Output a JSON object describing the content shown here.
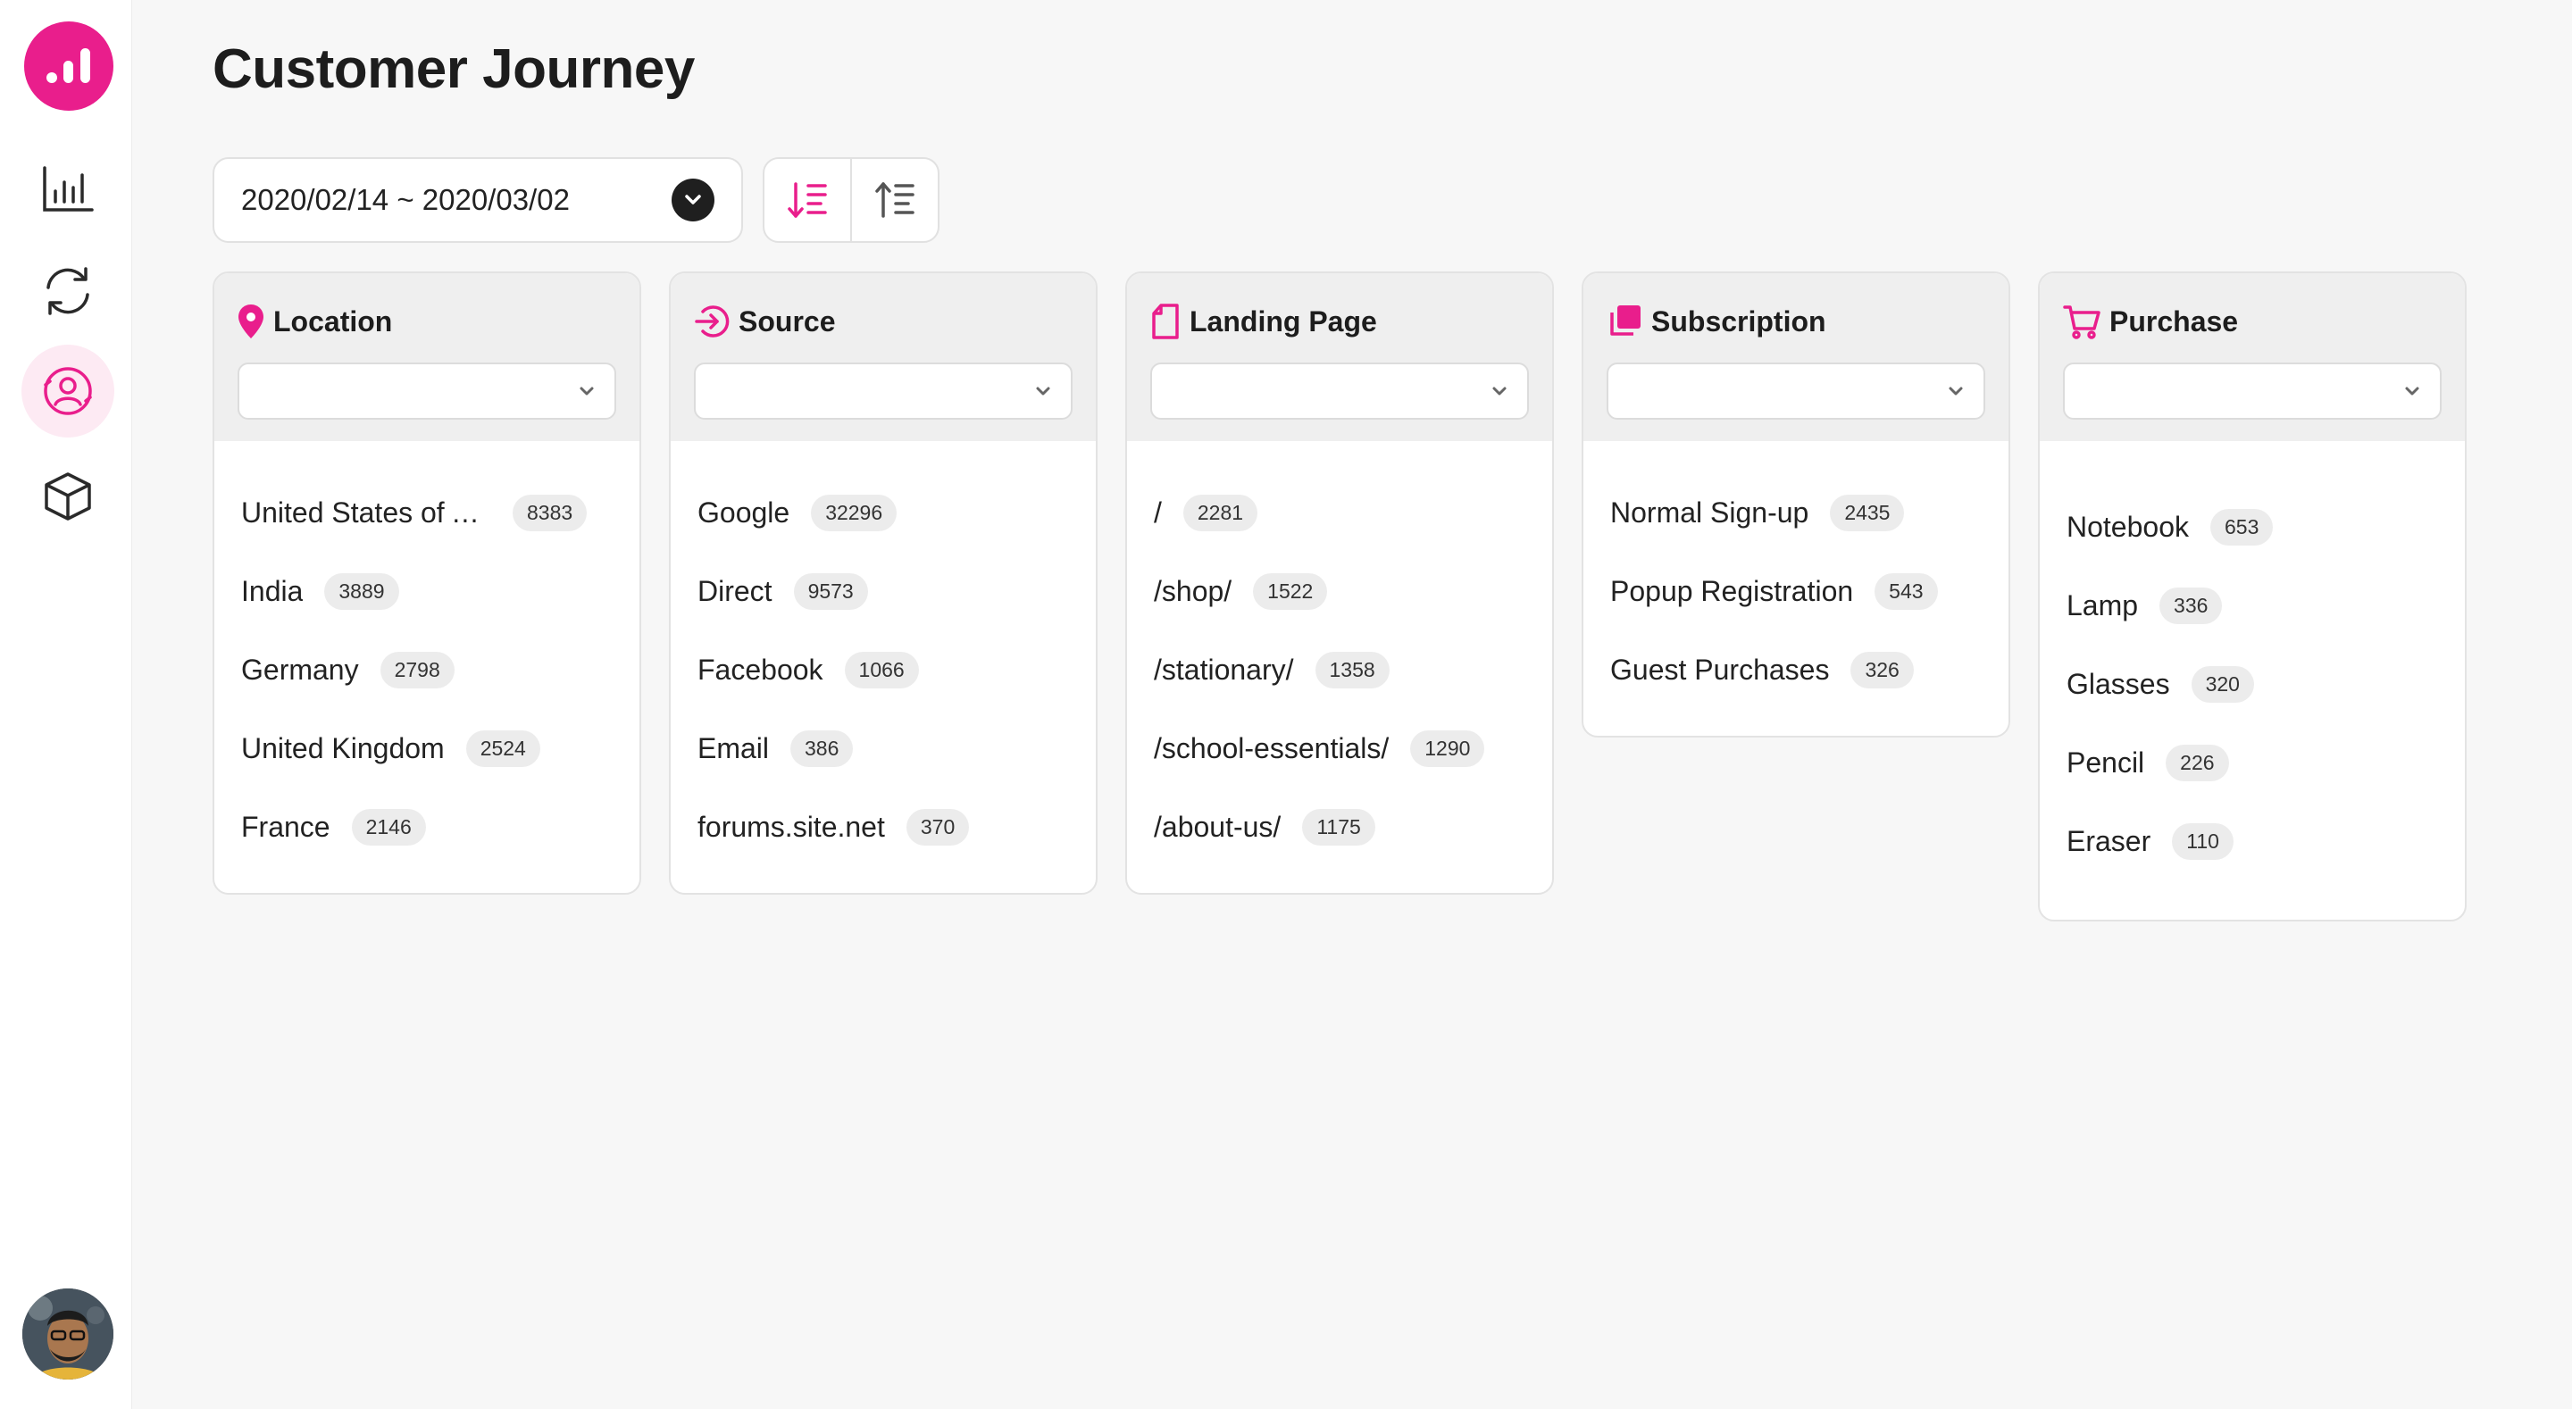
{
  "app": {
    "title": "Customer Journey"
  },
  "brand": {
    "accent": "#e91e8c"
  },
  "sidebar": {
    "items": [
      {
        "icon": "bar-chart-icon"
      },
      {
        "icon": "refresh-icon"
      },
      {
        "icon": "user-journey-icon",
        "active": true
      },
      {
        "icon": "cube-icon"
      }
    ]
  },
  "toolbar": {
    "date_range": "2020/02/14 ~ 2020/03/02"
  },
  "cards": [
    {
      "title": "Location",
      "icon": "location-pin-icon",
      "select_value": "",
      "items": [
        {
          "label": "United States of A...",
          "count": "8383"
        },
        {
          "label": "India",
          "count": "3889"
        },
        {
          "label": "Germany",
          "count": "2798"
        },
        {
          "label": "United Kingdom",
          "count": "2524"
        },
        {
          "label": "France",
          "count": "2146"
        }
      ]
    },
    {
      "title": "Source",
      "icon": "source-enter-icon",
      "select_value": "",
      "items": [
        {
          "label": "Google",
          "count": "32296"
        },
        {
          "label": "Direct",
          "count": "9573"
        },
        {
          "label": "Facebook",
          "count": "1066"
        },
        {
          "label": "Email",
          "count": "386"
        },
        {
          "label": "forums.site.net",
          "count": "370"
        }
      ]
    },
    {
      "title": "Landing Page",
      "icon": "page-icon",
      "select_value": "",
      "items": [
        {
          "label": "/",
          "count": "2281"
        },
        {
          "label": "/shop/",
          "count": "1522"
        },
        {
          "label": "/stationary/",
          "count": "1358"
        },
        {
          "label": "/school-essentials/",
          "count": "1290"
        },
        {
          "label": "/about-us/",
          "count": "1175"
        }
      ]
    },
    {
      "title": "Subscription",
      "icon": "subscription-icon",
      "select_value": "",
      "items": [
        {
          "label": "Normal Sign-up",
          "count": "2435"
        },
        {
          "label": "Popup Registration",
          "count": "543"
        },
        {
          "label": "Guest Purchases",
          "count": "326"
        }
      ]
    },
    {
      "title": "Purchase",
      "icon": "cart-icon",
      "select_value": "",
      "items": [
        {
          "label": "Notebook",
          "count": "653"
        },
        {
          "label": "Lamp",
          "count": "336"
        },
        {
          "label": "Glasses",
          "count": "320"
        },
        {
          "label": "Pencil",
          "count": "226"
        },
        {
          "label": "Eraser",
          "count": "110"
        }
      ]
    }
  ]
}
